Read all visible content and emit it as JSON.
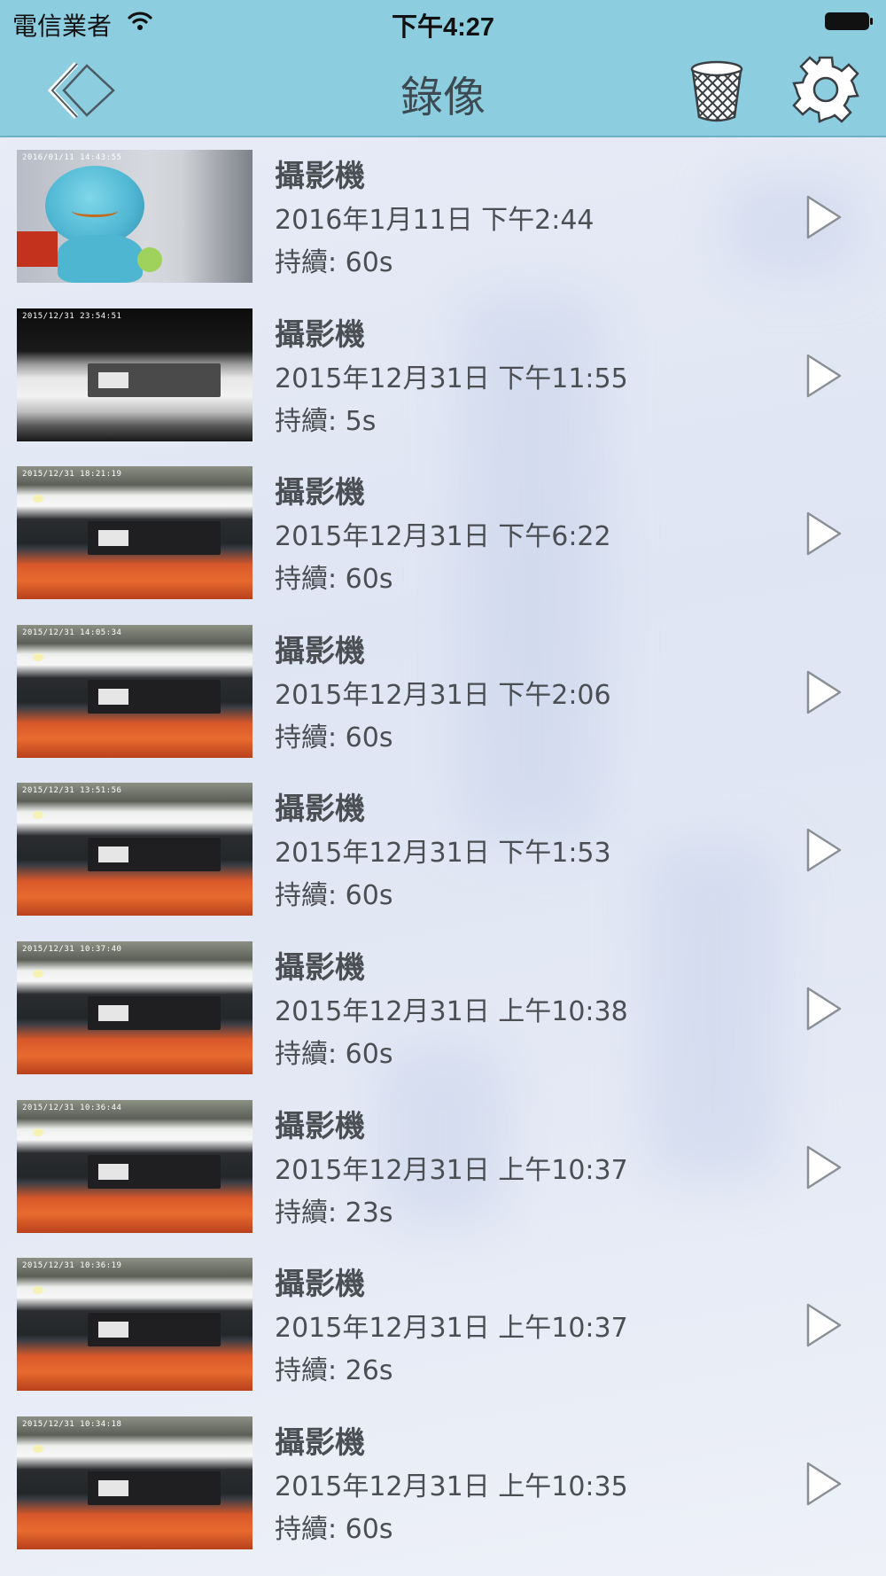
{
  "status_bar": {
    "carrier": "電信業者",
    "time": "下午4:27"
  },
  "nav": {
    "title": "錄像",
    "back_icon": "back-chevron-icon",
    "trash_icon": "trash-icon",
    "settings_icon": "gear-icon"
  },
  "recordings": [
    {
      "title": "攝影機",
      "date": "2016年1月11日 下午2:44",
      "duration": "持續: 60s",
      "stamp": "2016/01/11 14:43:55"
    },
    {
      "title": "攝影機",
      "date": "2015年12月31日 下午11:55",
      "duration": "持續: 5s",
      "stamp": "2015/12/31 23:54:51"
    },
    {
      "title": "攝影機",
      "date": "2015年12月31日 下午6:22",
      "duration": "持續: 60s",
      "stamp": "2015/12/31 18:21:19"
    },
    {
      "title": "攝影機",
      "date": "2015年12月31日 下午2:06",
      "duration": "持續: 60s",
      "stamp": "2015/12/31 14:05:34"
    },
    {
      "title": "攝影機",
      "date": "2015年12月31日 下午1:53",
      "duration": "持續: 60s",
      "stamp": "2015/12/31 13:51:56"
    },
    {
      "title": "攝影機",
      "date": "2015年12月31日 上午10:38",
      "duration": "持續: 60s",
      "stamp": "2015/12/31 10:37:40"
    },
    {
      "title": "攝影機",
      "date": "2015年12月31日 上午10:37",
      "duration": "持續: 23s",
      "stamp": "2015/12/31 10:36:44"
    },
    {
      "title": "攝影機",
      "date": "2015年12月31日 上午10:37",
      "duration": "持續: 26s",
      "stamp": "2015/12/31 10:36:19"
    },
    {
      "title": "攝影機",
      "date": "2015年12月31日 上午10:35",
      "duration": "持續: 60s",
      "stamp": "2015/12/31 10:34:18"
    }
  ]
}
